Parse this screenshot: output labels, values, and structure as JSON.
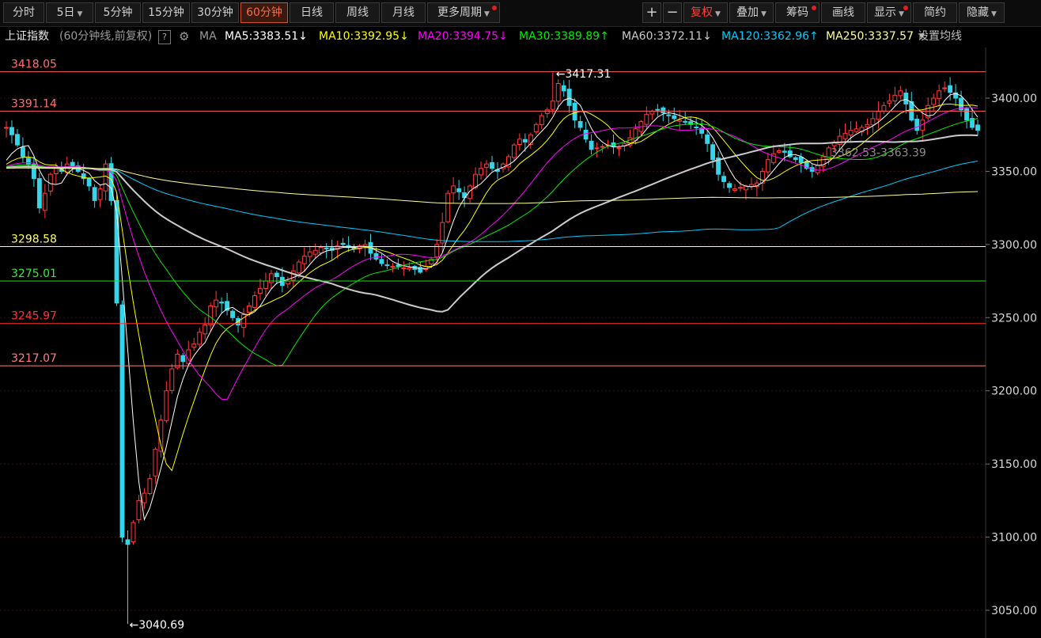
{
  "toolbar": {
    "left_tabs": [
      {
        "label": "分时",
        "active": false
      },
      {
        "label": "5日",
        "active": false,
        "caret": true
      },
      {
        "label": "5分钟",
        "active": false
      },
      {
        "label": "15分钟",
        "active": false
      },
      {
        "label": "30分钟",
        "active": false
      },
      {
        "label": "60分钟",
        "active": true
      },
      {
        "label": "日线",
        "active": false
      },
      {
        "label": "周线",
        "active": false
      },
      {
        "label": "月线",
        "active": false
      },
      {
        "label": "更多周期",
        "active": false,
        "caret": true,
        "dot": true
      }
    ],
    "right_tools": [
      {
        "label": "+",
        "name": "zoom-in-button"
      },
      {
        "label": "−",
        "name": "zoom-out-button"
      },
      {
        "label": "复权",
        "name": "adjust-button",
        "caret": true,
        "accent": true
      },
      {
        "label": "叠加",
        "name": "overlay-button",
        "caret": true
      },
      {
        "label": "筹码",
        "name": "chips-button",
        "dot": true
      },
      {
        "label": "画线",
        "name": "draw-line-button"
      },
      {
        "label": "显示",
        "name": "display-button",
        "caret": true,
        "dot": true
      },
      {
        "label": "简约",
        "name": "simple-button"
      },
      {
        "label": "隐藏",
        "name": "hide-button",
        "caret": true
      }
    ]
  },
  "info": {
    "index_name": "上证指数",
    "period_desc": "(60分钟线,前复权)",
    "help": "?",
    "ma_label": "MA",
    "ma": [
      {
        "text": "MA5:3383.51",
        "arrow": "↓",
        "color": "#ffffff"
      },
      {
        "text": "MA10:3392.95",
        "arrow": "↓",
        "color": "#ffff00"
      },
      {
        "text": "MA20:3394.75",
        "arrow": "↓",
        "color": "#ff00ff"
      },
      {
        "text": "MA30:3389.89",
        "arrow": "↑",
        "color": "#00ee00"
      },
      {
        "text": "MA60:3372.11",
        "arrow": "↓",
        "color": "#cccccc"
      },
      {
        "text": "MA120:3362.96",
        "arrow": "↑",
        "color": "#00ccff"
      },
      {
        "text": "MA250:3337.57",
        "arrow": "",
        "color": "#ffff99"
      }
    ],
    "settings": "设置均线"
  },
  "chart_data": {
    "type": "candlestick",
    "ylim": [
      3045,
      3430
    ],
    "y_ticks": [
      "3400.00",
      "3350.00",
      "3300.00",
      "3250.00",
      "3200.00",
      "3150.00",
      "3100.00",
      "3050.00"
    ],
    "y_tick_values": [
      3400,
      3350,
      3300,
      3250,
      3200,
      3150,
      3100,
      3050
    ],
    "grid": "horizontal dotted",
    "levels": [
      {
        "value": 3418.05,
        "label": "3418.05",
        "color": "#ff6060",
        "label_color": "#ff7070"
      },
      {
        "value": 3391.14,
        "label": "3391.14",
        "color": "#ff6060",
        "label_color": "#ff7070"
      },
      {
        "value": 3298.58,
        "label": "3298.58",
        "color": "#ffff80",
        "label_color": "#ffff66"
      },
      {
        "value": 3275.01,
        "label": "3275.01",
        "color": "#22dd22",
        "label_color": "#33ee33"
      },
      {
        "value": 3245.97,
        "label": "3245.97",
        "color": "#ff3030",
        "label_color": "#ff3333"
      },
      {
        "value": 3217.07,
        "label": "3217.07",
        "color": "#ff8080",
        "label_color": "#ff8080"
      }
    ],
    "annotations": [
      {
        "text": "3417.31",
        "value": 3417.31
      },
      {
        "text": "3040.69",
        "value": 3040.69
      },
      {
        "text": "3362.53-3363.39",
        "value": 3363
      }
    ],
    "closes": [
      3380,
      3375,
      3368,
      3360,
      3355,
      3345,
      3325,
      3335,
      3348,
      3352,
      3350,
      3355,
      3353,
      3350,
      3345,
      3340,
      3330,
      3338,
      3355,
      3330,
      3260,
      3100,
      3095,
      3110,
      3125,
      3130,
      3140,
      3160,
      3180,
      3200,
      3215,
      3225,
      3220,
      3228,
      3232,
      3240,
      3245,
      3258,
      3262,
      3260,
      3255,
      3250,
      3245,
      3252,
      3258,
      3265,
      3270,
      3275,
      3280,
      3278,
      3272,
      3275,
      3282,
      3288,
      3292,
      3295,
      3296,
      3298,
      3297,
      3296,
      3299,
      3300,
      3298,
      3297,
      3299,
      3300,
      3294,
      3290,
      3287,
      3286,
      3285,
      3285,
      3284,
      3284,
      3283,
      3281,
      3285,
      3290,
      3300,
      3315,
      3335,
      3340,
      3336,
      3332,
      3340,
      3348,
      3352,
      3355,
      3352,
      3350,
      3355,
      3360,
      3368,
      3372,
      3370,
      3375,
      3382,
      3388,
      3392,
      3398,
      3410,
      3405,
      3395,
      3385,
      3380,
      3372,
      3365,
      3366,
      3367,
      3368,
      3367,
      3366,
      3369,
      3373,
      3379,
      3384,
      3389,
      3391,
      3392,
      3390,
      3388,
      3386,
      3385,
      3384,
      3382,
      3380,
      3376,
      3369,
      3358,
      3348,
      3343,
      3339,
      3338,
      3339,
      3340,
      3341,
      3342,
      3350,
      3358,
      3362,
      3364,
      3363,
      3360,
      3358,
      3356,
      3352,
      3350,
      3354,
      3360,
      3366,
      3370,
      3374,
      3376,
      3378,
      3379,
      3380,
      3382,
      3386,
      3391,
      3395,
      3398,
      3402,
      3405,
      3396,
      3385,
      3378,
      3385,
      3395,
      3400,
      3405,
      3407,
      3404,
      3400,
      3392,
      3385,
      3380,
      3378
    ]
  }
}
